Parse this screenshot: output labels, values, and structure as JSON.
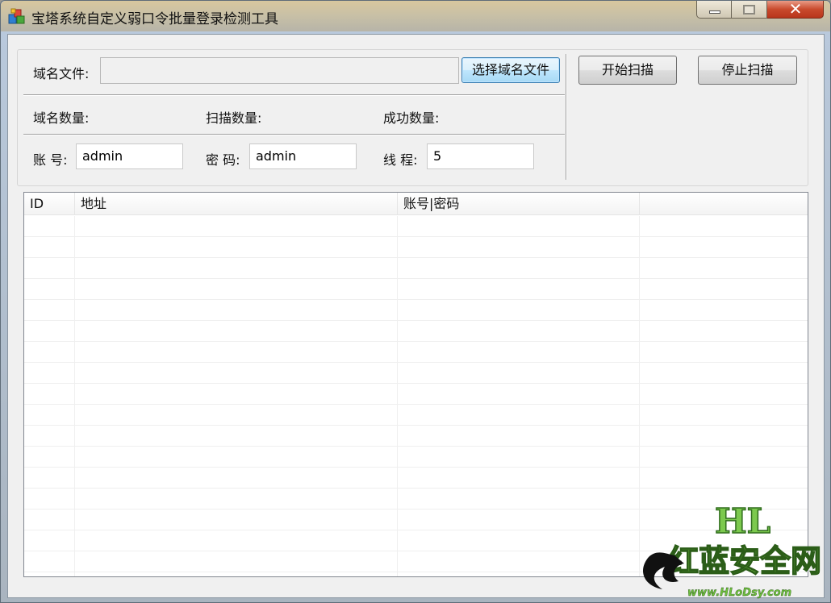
{
  "window": {
    "title": "宝塔系统自定义弱口令批量登录检测工具"
  },
  "domain_file": {
    "label": "域名文件:",
    "value": "",
    "browse_button": "选择域名文件"
  },
  "actions": {
    "start_button": "开始扫描",
    "stop_button": "停止扫描"
  },
  "stats": {
    "domain_count_label": "域名数量:",
    "scan_count_label": "扫描数量:",
    "success_count_label": "成功数量:"
  },
  "credentials": {
    "account_label": "账 号:",
    "account_value": "admin",
    "password_label": "密 码:",
    "password_value": "admin",
    "threads_label": "线 程:",
    "threads_value": "5"
  },
  "table": {
    "columns": [
      "ID",
      "地址",
      "账号|密码",
      ""
    ],
    "rows": []
  },
  "watermark": {
    "logo_text": "HL",
    "site_name": "红蓝安全网",
    "url": "www.HLoDsy.com"
  }
}
